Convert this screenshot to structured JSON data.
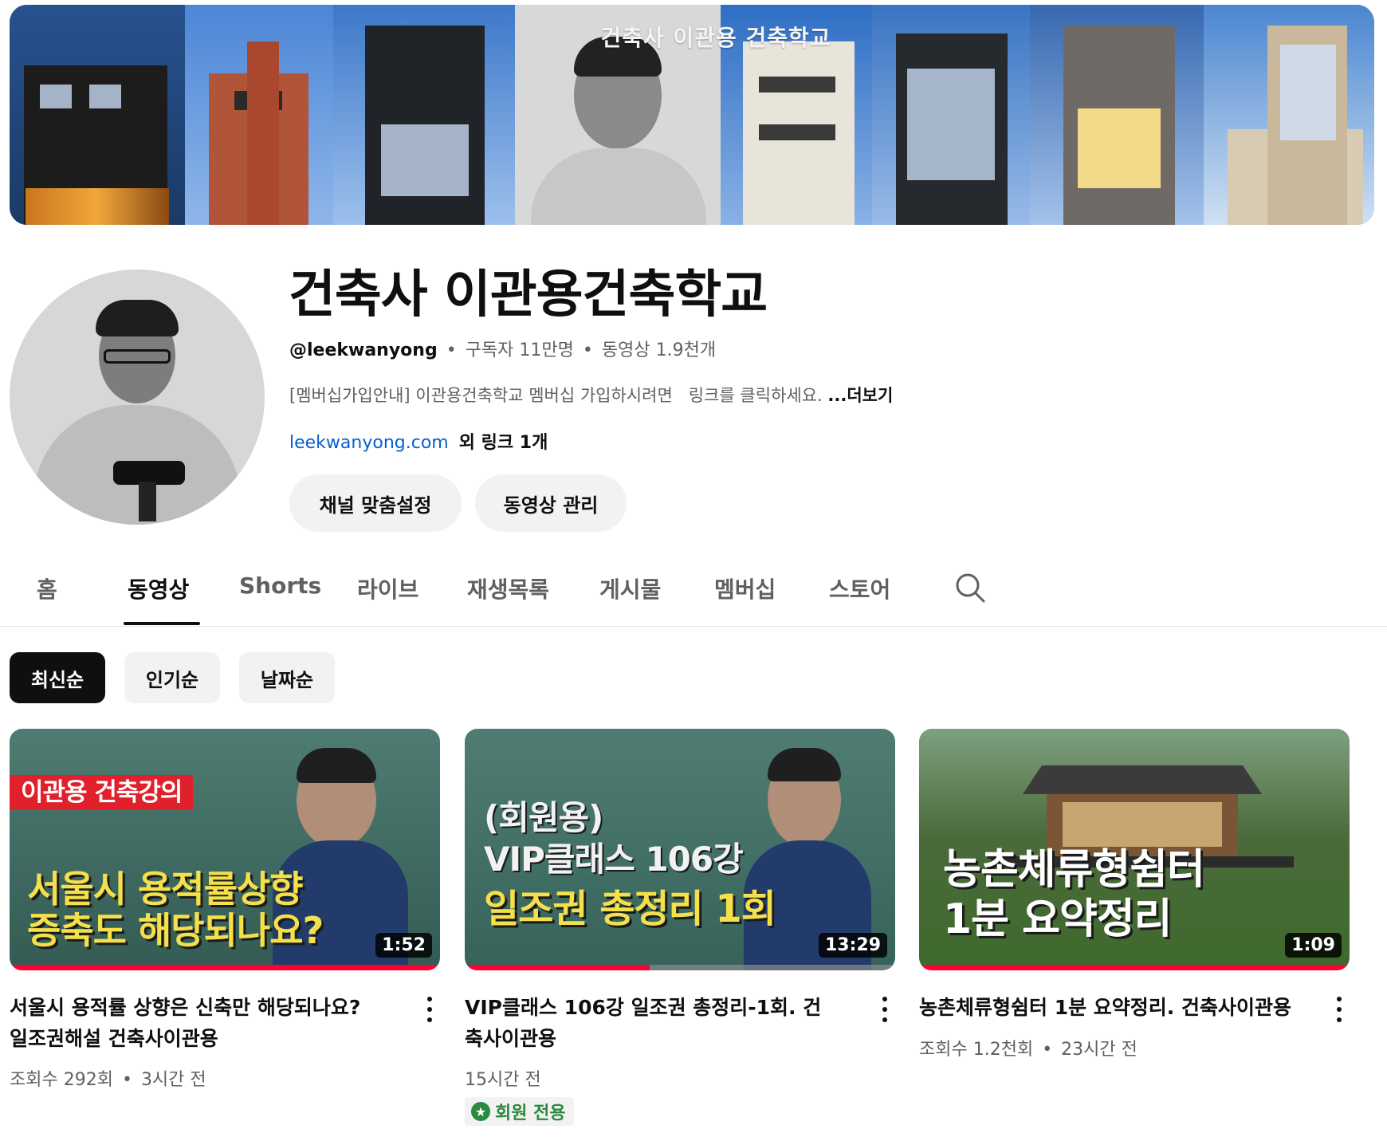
{
  "banner": {
    "title": "건축사 이관용 건축학교"
  },
  "channel": {
    "name": "건축사 이관용건축학교",
    "handle": "@leekwanyong",
    "subscribers": "구독자 11만명",
    "videos": "동영상 1.9천개",
    "separator": "•",
    "description": "[멤버십가입안내] 이관용건축학교 멤버십 가입하시려면   링크를 클릭하세요.",
    "more": "...더보기",
    "link_url": "leekwanyong.com",
    "link_extra": "외 링크 1개",
    "customize_button": "채널 맞춤설정",
    "manage_button": "동영상 관리"
  },
  "tabs": [
    {
      "label": "홈"
    },
    {
      "label": "동영상",
      "active": true
    },
    {
      "label": "Shorts"
    },
    {
      "label": "라이브"
    },
    {
      "label": "재생목록"
    },
    {
      "label": "게시물"
    },
    {
      "label": "멤버십"
    },
    {
      "label": "스토어"
    }
  ],
  "chips": [
    {
      "label": "최신순",
      "active": true
    },
    {
      "label": "인기순"
    },
    {
      "label": "날짜순"
    }
  ],
  "videos": [
    {
      "title": "서울시 용적률 상향은 신축만 해당되나요? 일조권해설 건축사이관용",
      "views": "조회수 292회",
      "age": "3시간 전",
      "duration": "1:52",
      "progress": 1.0,
      "thumb_tag": "이관용 건축강의",
      "thumb_line1": "서울시 용적률상향",
      "thumb_line2": "증축도 해당되나요?"
    },
    {
      "title": "VIP클래스 106강 일조권 총정리-1회. 건축사이관용",
      "views": "",
      "age": "15시간 전",
      "duration": "13:29",
      "progress": 0.43,
      "badge": "회원 전용",
      "thumb_line1": "(회원용)",
      "thumb_line2": "VIP클래스 106강",
      "thumb_line3": "일조권 총정리 1회"
    },
    {
      "title": "농촌체류형쉼터 1분 요약정리. 건축사이관용",
      "views": "조회수 1.2천회",
      "age": "23시간 전",
      "duration": "1:09",
      "progress": 1.0,
      "thumb_line1": "농촌체류형쉼터",
      "thumb_line2": "1분 요약정리"
    }
  ],
  "icons": {
    "search": "search-icon",
    "more": "more-vert-icon",
    "members": "star-icon"
  },
  "colors": {
    "link": "#065fd4",
    "progress": "#ff0033",
    "members": "#2b8a3e"
  }
}
